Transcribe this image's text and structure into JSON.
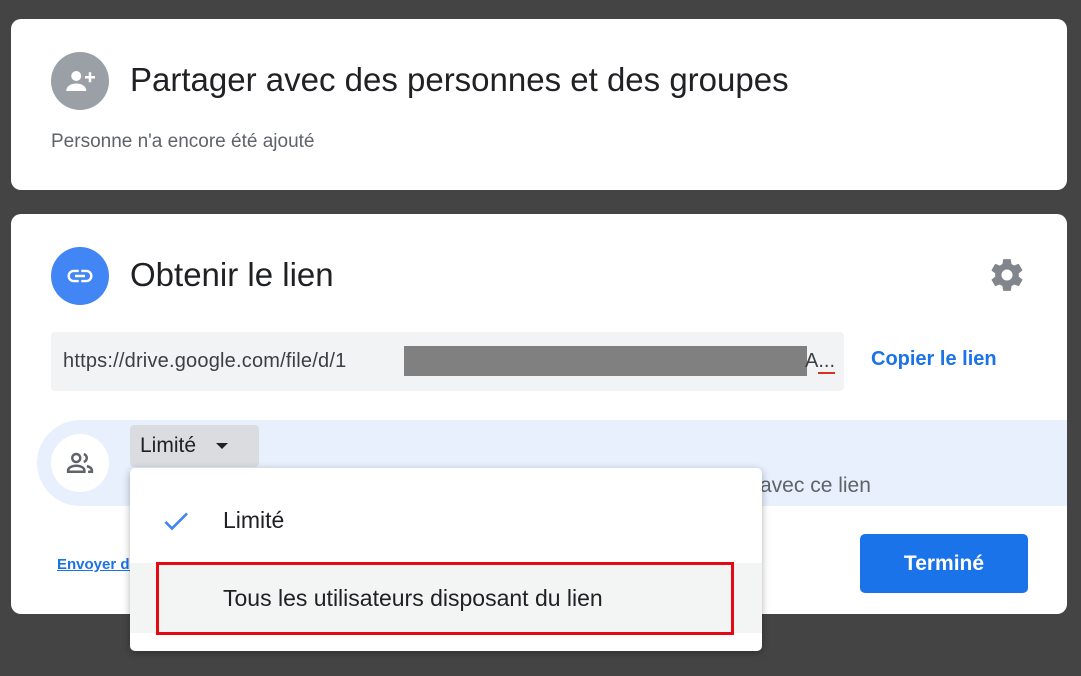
{
  "share": {
    "title": "Partager avec des personnes et des groupes",
    "subtitle": "Personne n'a encore été ajouté",
    "icon": "person-add-icon"
  },
  "link": {
    "title": "Obtenir le lien",
    "icon": "link-icon",
    "settings_icon": "gear-icon",
    "url_visible": "https://drive.google.com/file/d/1",
    "url_tail": "A",
    "url_ellipsis": "...",
    "copy_label": "Copier le lien"
  },
  "access": {
    "dropdown_label": "Limité",
    "description_fragment": "avec ce lien",
    "icon": "people-icon"
  },
  "footer": {
    "send_feedback_label": "Envoyer des commentaires à Google",
    "done_label": "Terminé"
  },
  "menu": {
    "items": [
      {
        "label": "Limité",
        "selected": true
      },
      {
        "label": "Tous les utilisateurs disposant du lien",
        "selected": false
      }
    ]
  },
  "colors": {
    "accent": "#1a73e8",
    "link_icon_bg": "#4285f4",
    "highlight": "#e50914"
  }
}
